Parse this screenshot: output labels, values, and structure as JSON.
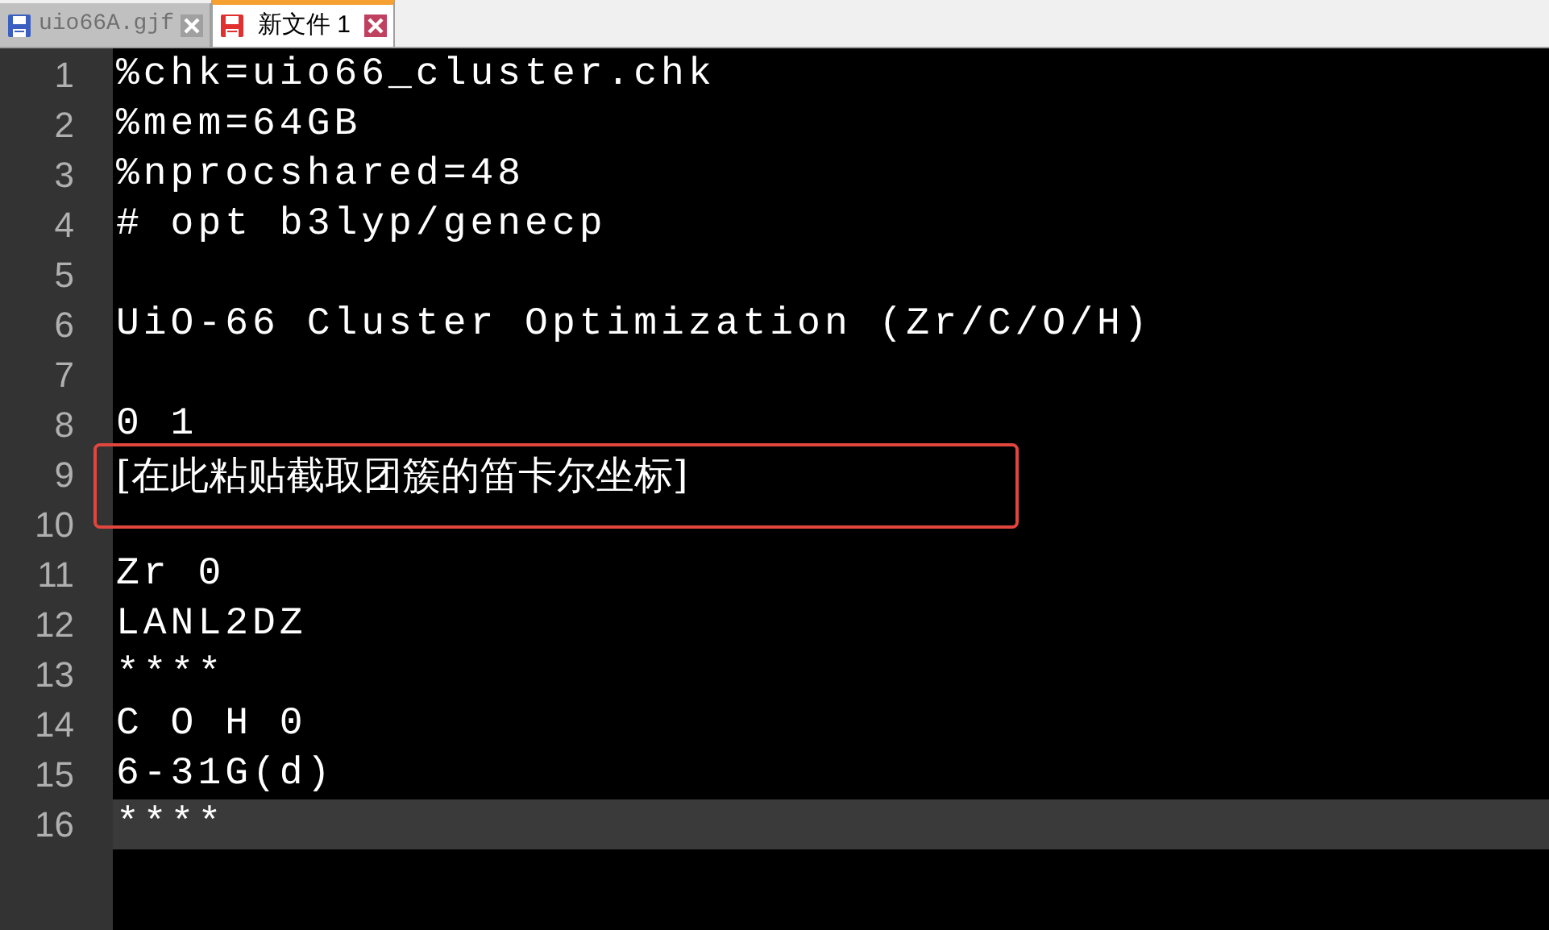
{
  "tabs": [
    {
      "label": "uio66A.gjf",
      "selected": false,
      "saved": true
    },
    {
      "label": "新文件 1",
      "selected": true,
      "saved": false
    }
  ],
  "editor": {
    "lines": [
      {
        "number": "1",
        "text": "%chk=uio66_cluster.chk",
        "current": false,
        "boxed": false
      },
      {
        "number": "2",
        "text": "%mem=64GB",
        "current": false,
        "boxed": false
      },
      {
        "number": "3",
        "text": "%nprocshared=48",
        "current": false,
        "boxed": false
      },
      {
        "number": "4",
        "text": "# opt b3lyp/genecp",
        "current": false,
        "boxed": false
      },
      {
        "number": "5",
        "current": false,
        "boxed": false
      },
      {
        "number": "6",
        "text": "UiO-66 Cluster Optimization (Zr/C/O/H)",
        "current": false,
        "boxed": false
      },
      {
        "number": "7",
        "current": false,
        "boxed": false
      },
      {
        "number": "8",
        "text": "0 1",
        "current": false,
        "boxed": false
      },
      {
        "number": "9",
        "text": "[在此粘贴截取团簇的笛卡尔坐标]",
        "current": false,
        "boxed": true
      },
      {
        "number": "10",
        "current": false,
        "boxed": false
      },
      {
        "number": "11",
        "text": "Zr 0",
        "current": false,
        "boxed": false
      },
      {
        "number": "12",
        "text": "LANL2DZ",
        "current": false,
        "boxed": false
      },
      {
        "number": "13",
        "text": "****",
        "current": false,
        "boxed": false
      },
      {
        "number": "14",
        "text": "C O H 0",
        "current": false,
        "boxed": false
      },
      {
        "number": "15",
        "text": "6-31G(d)",
        "current": false,
        "boxed": false
      },
      {
        "number": "16",
        "text": "****",
        "current": true,
        "boxed": false
      }
    ]
  }
}
